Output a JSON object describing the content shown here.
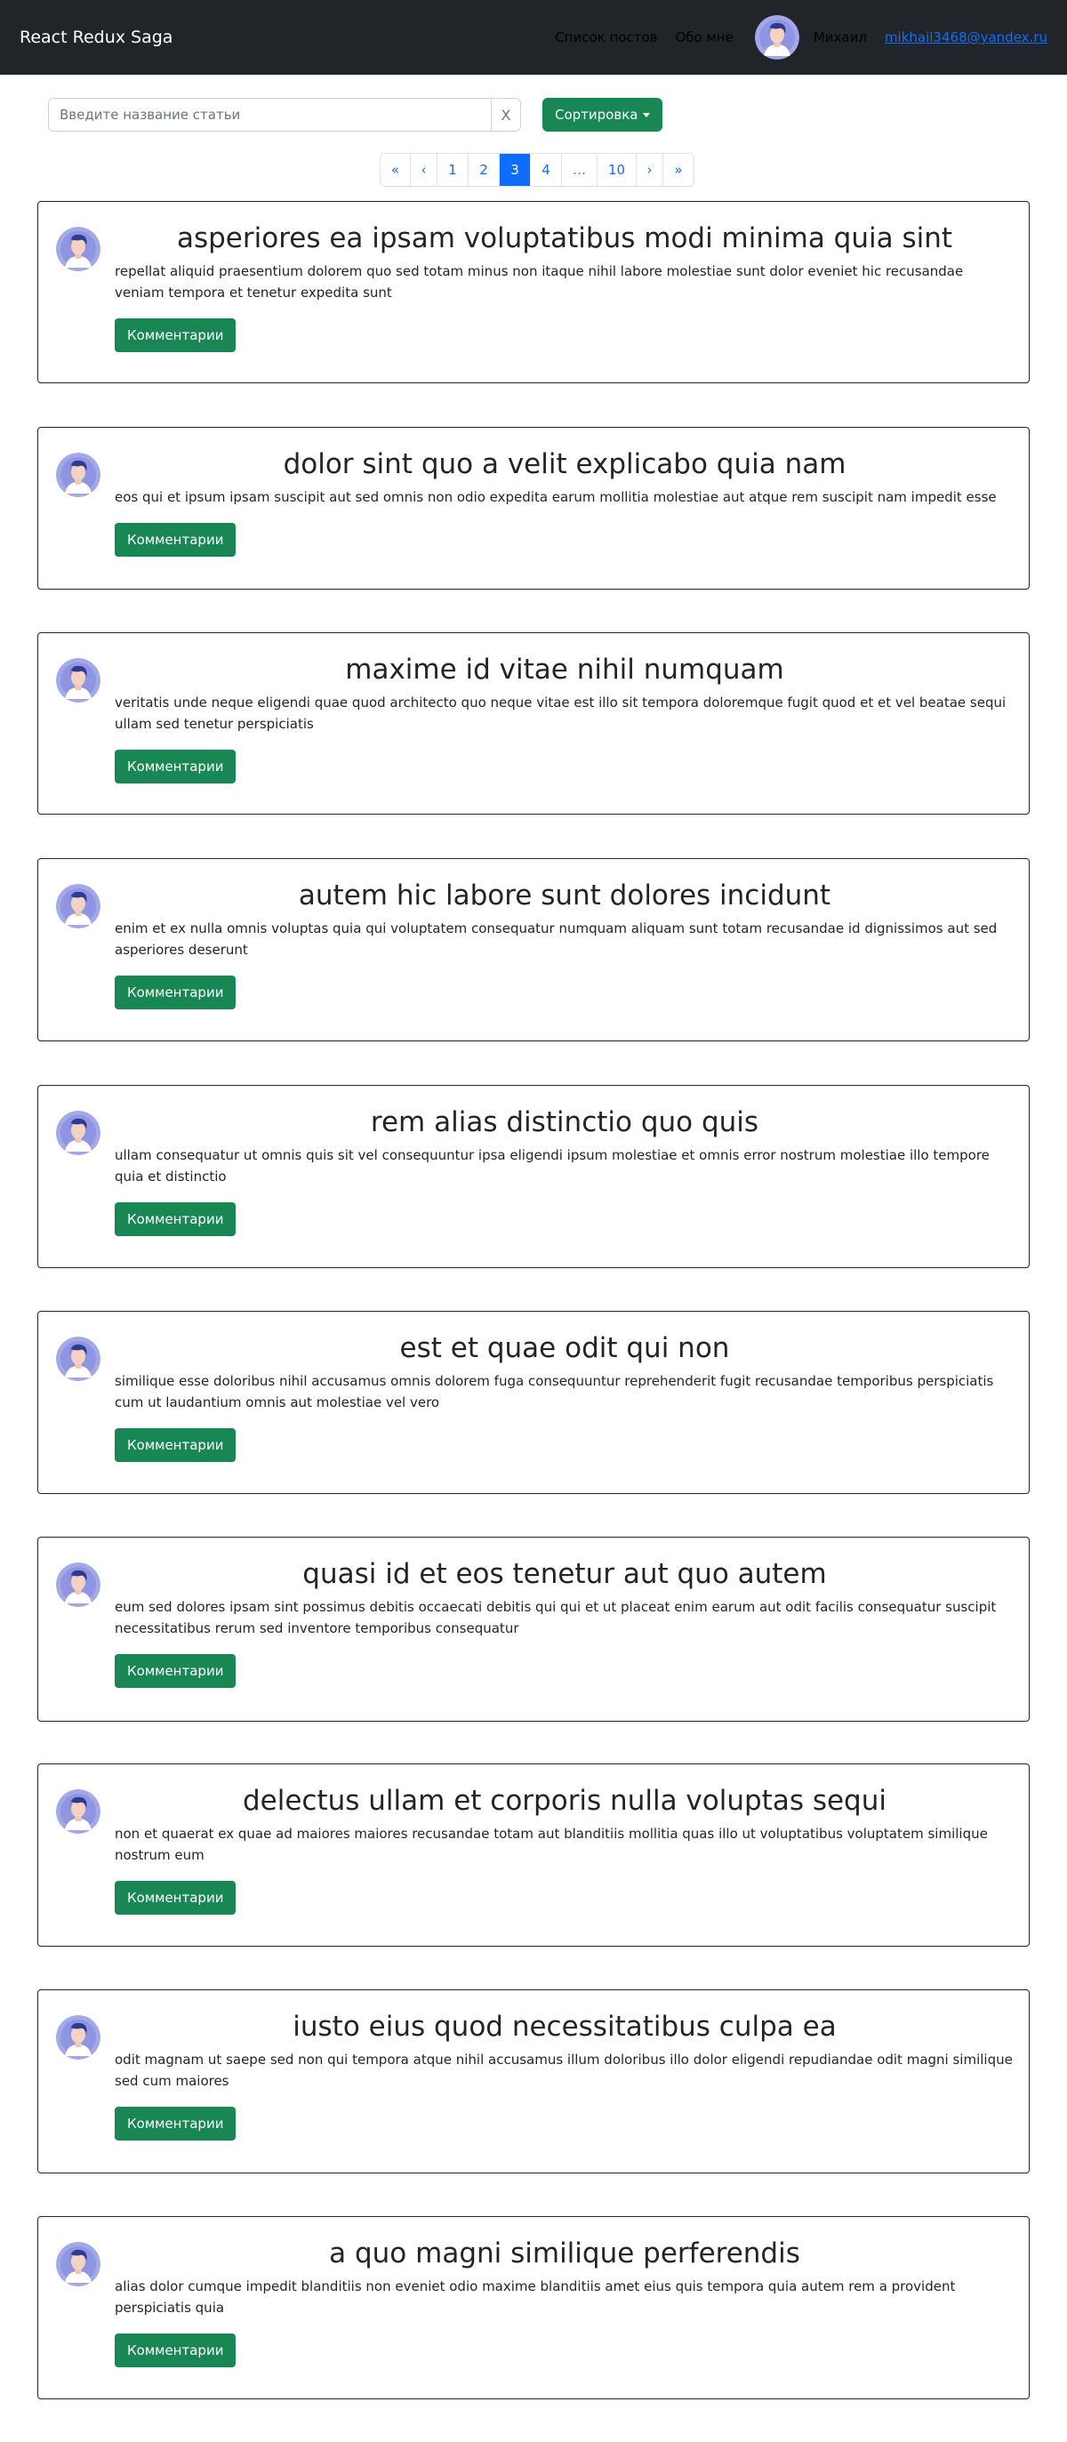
{
  "navbar": {
    "brand": "React Redux Saga",
    "links": [
      "Список постов",
      "Обо мне"
    ],
    "user_name": "Михаил",
    "user_email": "mikhail3468@yandex.ru"
  },
  "search": {
    "placeholder": "Введите название статьи",
    "value": "",
    "clear_label": "X",
    "sort_label": "Сортировка"
  },
  "pagination": {
    "items": [
      "«",
      "‹",
      "1",
      "2",
      "3",
      "4",
      "…",
      "10",
      "›",
      "»"
    ],
    "active": "3"
  },
  "colors": {
    "navbar_bg": "#212529",
    "accent_green": "#198754",
    "accent_blue": "#0d6efd"
  },
  "comments_label": "Комментарии",
  "posts": [
    {
      "title": "asperiores ea ipsam voluptatibus modi minima quia sint",
      "body": "repellat aliquid praesentium dolorem quo sed totam minus non itaque nihil labore molestiae sunt dolor eveniet hic recusandae veniam tempora et tenetur expedita sunt"
    },
    {
      "title": "dolor sint quo a velit explicabo quia nam",
      "body": "eos qui et ipsum ipsam suscipit aut sed omnis non odio expedita earum mollitia molestiae aut atque rem suscipit nam impedit esse"
    },
    {
      "title": "maxime id vitae nihil numquam",
      "body": "veritatis unde neque eligendi quae quod architecto quo neque vitae est illo sit tempora doloremque fugit quod et et vel beatae sequi ullam sed tenetur perspiciatis"
    },
    {
      "title": "autem hic labore sunt dolores incidunt",
      "body": "enim et ex nulla omnis voluptas quia qui voluptatem consequatur numquam aliquam sunt totam recusandae id dignissimos aut sed asperiores deserunt"
    },
    {
      "title": "rem alias distinctio quo quis",
      "body": "ullam consequatur ut omnis quis sit vel consequuntur ipsa eligendi ipsum molestiae et omnis error nostrum molestiae illo tempore quia et distinctio"
    },
    {
      "title": "est et quae odit qui non",
      "body": "similique esse doloribus nihil accusamus omnis dolorem fuga consequuntur reprehenderit fugit recusandae temporibus perspiciatis cum ut laudantium omnis aut molestiae vel vero"
    },
    {
      "title": "quasi id et eos tenetur aut quo autem",
      "body": "eum sed dolores ipsam sint possimus debitis occaecati debitis qui qui et ut placeat enim earum aut odit facilis consequatur suscipit necessitatibus rerum sed inventore temporibus consequatur"
    },
    {
      "title": "delectus ullam et corporis nulla voluptas sequi",
      "body": "non et quaerat ex quae ad maiores maiores recusandae totam aut blanditiis mollitia quas illo ut voluptatibus voluptatem similique nostrum eum"
    },
    {
      "title": "iusto eius quod necessitatibus culpa ea",
      "body": "odit magnam ut saepe sed non qui tempora atque nihil accusamus illum doloribus illo dolor eligendi repudiandae odit magni similique sed cum maiores"
    },
    {
      "title": "a quo magni similique perferendis",
      "body": "alias dolor cumque impedit blanditiis non eveniet odio maxime blanditiis amet eius quis tempora quia autem rem a provident perspiciatis quia"
    }
  ]
}
